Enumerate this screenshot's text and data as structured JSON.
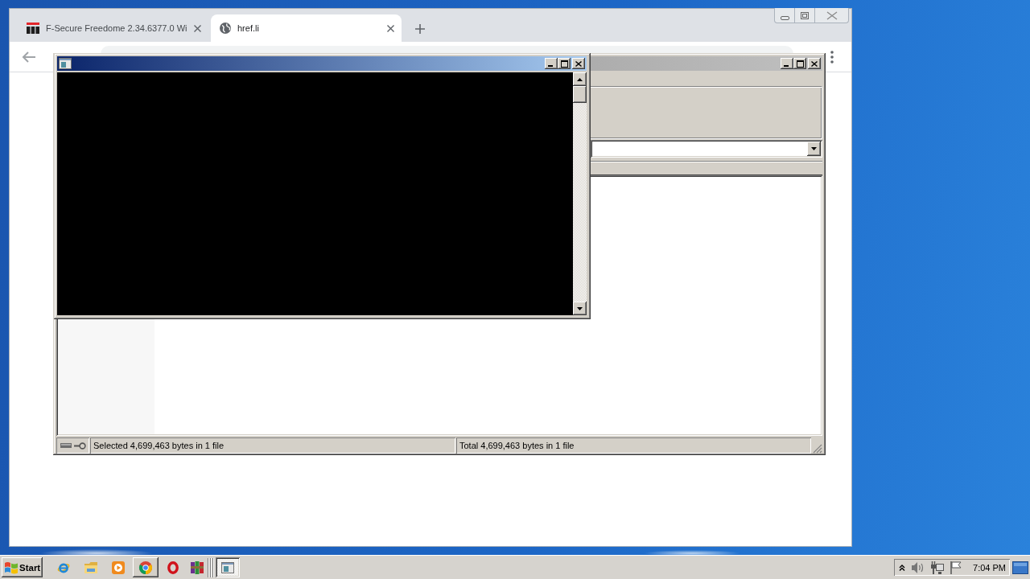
{
  "browser": {
    "tabs": [
      {
        "kind": "logo",
        "title": "F-Secure Freedome 2.34.6377.0 Wi",
        "selected": false
      },
      {
        "kind": "globe",
        "title": "href.li",
        "selected": true
      }
    ]
  },
  "archive_window": {
    "status_bar": [
      "Selected 4,699,463 bytes in 1 file",
      "Total 4,699,463 bytes in 1 file"
    ]
  },
  "taskbar": {
    "start": "Start",
    "clock": "7:04 PM"
  }
}
